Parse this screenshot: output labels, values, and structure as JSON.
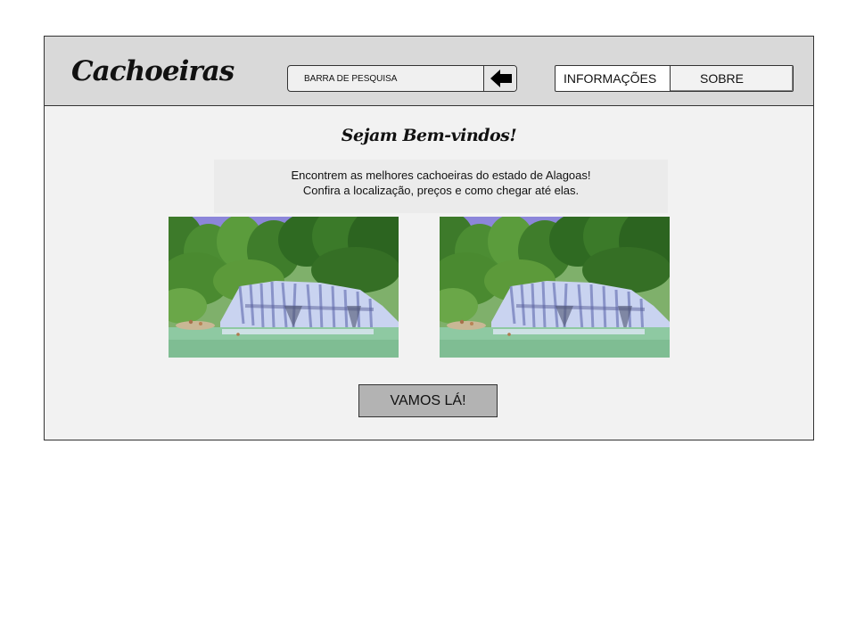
{
  "header": {
    "brand": "Cachoeiras",
    "search": {
      "placeholder": "BARRA DE PESQUISA",
      "button_icon": "arrow-left-icon"
    },
    "nav": {
      "items": [
        {
          "label": "INFORMAÇÕES"
        },
        {
          "label": "SOBRE"
        }
      ]
    }
  },
  "main": {
    "welcome": "Sejam Bem-vindos!",
    "intro": [
      "Encontrem as melhores cachoeiras do estado de Alagoas!",
      "Confira a localização, preços e como chegar até elas."
    ],
    "images": [
      {
        "icon": "waterfall-photo"
      },
      {
        "icon": "waterfall-photo"
      }
    ],
    "cta_label": "VAMOS LÁ!"
  },
  "colors": {
    "header_bg": "#d9d9d9",
    "content_bg": "#f2f2f2",
    "button_bg": "#b3b3b3",
    "border": "#333333"
  }
}
